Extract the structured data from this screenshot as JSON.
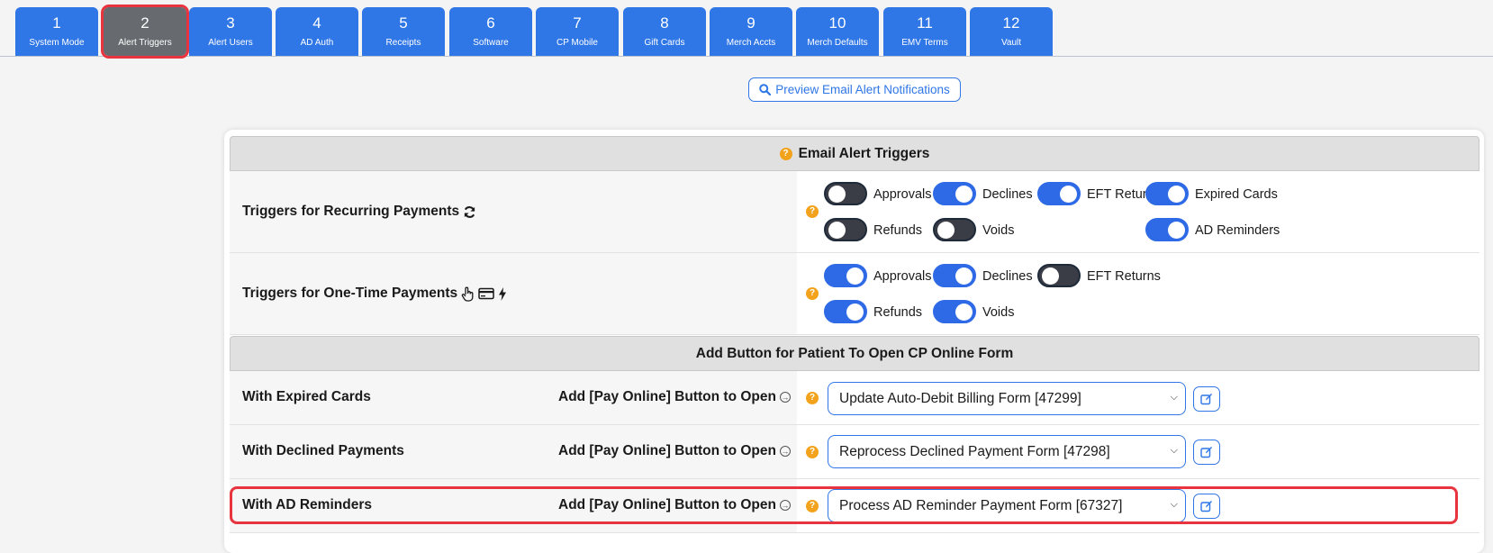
{
  "tabs": [
    {
      "num": "1",
      "label": "System Mode"
    },
    {
      "num": "2",
      "label": "Alert Triggers"
    },
    {
      "num": "3",
      "label": "Alert Users"
    },
    {
      "num": "4",
      "label": "AD Auth"
    },
    {
      "num": "5",
      "label": "Receipts"
    },
    {
      "num": "6",
      "label": "Software"
    },
    {
      "num": "7",
      "label": "CP Mobile"
    },
    {
      "num": "8",
      "label": "Gift Cards"
    },
    {
      "num": "9",
      "label": "Merch Accts"
    },
    {
      "num": "10",
      "label": "Merch Defaults"
    },
    {
      "num": "11",
      "label": "EMV Terms"
    },
    {
      "num": "12",
      "label": "Vault"
    }
  ],
  "active_tab": "2",
  "preview_button": {
    "label": "Preview Email Alert Notifications"
  },
  "email_section": {
    "title": "Email Alert Triggers",
    "recurring": {
      "label": "Triggers for Recurring Payments",
      "toggles": [
        {
          "label": "Approvals",
          "on": false
        },
        {
          "label": "Declines",
          "on": true
        },
        {
          "label": "EFT Returns",
          "on": true
        },
        {
          "label": "Expired Cards",
          "on": true
        },
        {
          "label": "Refunds",
          "on": false
        },
        {
          "label": "Voids",
          "on": false
        },
        {
          "label": "AD Reminders",
          "on": true
        }
      ]
    },
    "onetime": {
      "label": "Triggers for One-Time Payments",
      "toggles": [
        {
          "label": "Approvals",
          "on": true
        },
        {
          "label": "Declines",
          "on": true
        },
        {
          "label": "EFT Returns",
          "on": false
        },
        {
          "label": "Refunds",
          "on": true
        },
        {
          "label": "Voids",
          "on": true
        }
      ]
    }
  },
  "button_section": {
    "title": "Add Button for Patient To Open CP Online Form",
    "subtext": "Add [Pay Online] Button to Open",
    "rows": [
      {
        "label": "With Expired Cards",
        "selected": "Update Auto-Debit Billing Form [47299]"
      },
      {
        "label": "With Declined Payments",
        "selected": "Reprocess Declined Payment Form [47298]"
      },
      {
        "label": "With AD Reminders",
        "selected": "Process AD Reminder Payment Form [67327]"
      }
    ]
  },
  "colors": {
    "accent": "#2f76e6",
    "highlight": "#e8343f",
    "help": "#f2a31b",
    "toggle_on": "#2f6ae6",
    "toggle_off": "#3a3d45"
  }
}
